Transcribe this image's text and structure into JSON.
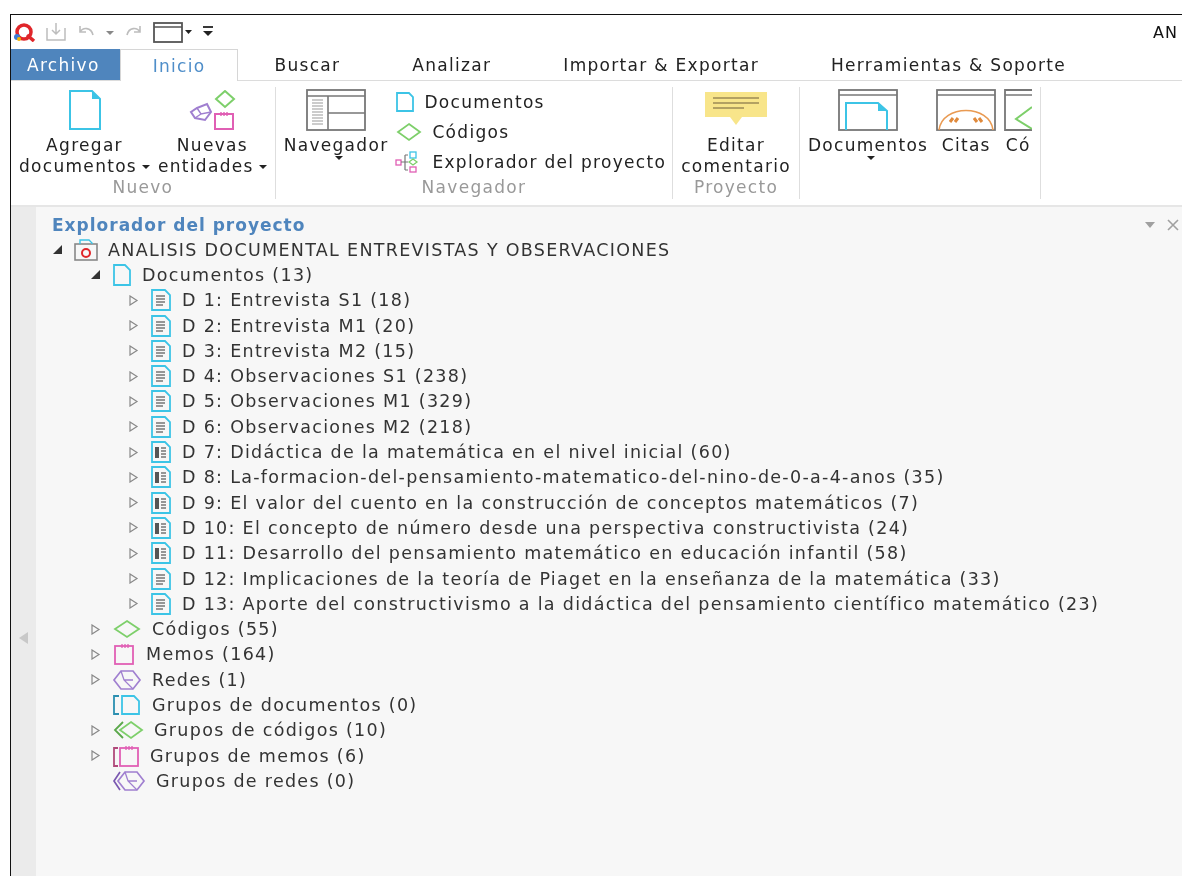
{
  "window": {
    "title": "AN"
  },
  "tabs": [
    {
      "label": "Archivo",
      "kind": "file",
      "selected": false
    },
    {
      "label": "Inicio",
      "kind": "tab",
      "selected": true
    },
    {
      "label": "Buscar",
      "kind": "tab",
      "selected": false
    },
    {
      "label": "Analizar",
      "kind": "tab",
      "selected": false
    },
    {
      "label": "Importar & Exportar",
      "kind": "tab",
      "selected": false
    },
    {
      "label": "Herramientas & Soporte",
      "kind": "tab",
      "selected": false
    }
  ],
  "ribbon": [
    {
      "label": "Nuevo",
      "buttons": [
        {
          "lines": [
            "Agregar",
            "documentos"
          ],
          "dropdown": true
        },
        {
          "lines": [
            "Nuevas",
            "entidades"
          ],
          "dropdown": true
        }
      ]
    },
    {
      "label": "Navegador",
      "buttons": [
        {
          "lines": [
            "Navegador"
          ],
          "dropdown": true
        }
      ],
      "stack": [
        {
          "label": "Documentos"
        },
        {
          "label": "Códigos"
        },
        {
          "label": "Explorador del proyecto"
        }
      ]
    },
    {
      "label": "Proyecto",
      "buttons": [
        {
          "lines": [
            "Editar",
            "comentario"
          ],
          "dropdown": false
        }
      ]
    },
    {
      "buttons": [
        {
          "lines": [
            "Documentos"
          ],
          "dropdown": true
        },
        {
          "lines": [
            "Citas"
          ],
          "dropdown": false
        },
        {
          "lines": [
            "Có"
          ],
          "dropdown": false
        }
      ]
    }
  ],
  "panel": {
    "title": "Explorador del proyecto"
  },
  "tree": [
    {
      "label": "ANALISIS DOCUMENTAL ENTREVISTAS Y OBSERVACIONES",
      "kind": "project",
      "expandable": true,
      "expanded": true,
      "children": [
        {
          "label": "Documentos (13)",
          "kind": "documents",
          "expandable": true,
          "expanded": true,
          "children": [
            {
              "label": "D 1: Entrevista S1 (18)",
              "kind": "text-doc",
              "expandable": true,
              "expanded": false
            },
            {
              "label": "D 2: Entrevista M1 (20)",
              "kind": "text-doc",
              "expandable": true,
              "expanded": false
            },
            {
              "label": "D 3: Entrevista M2 (15)",
              "kind": "text-doc",
              "expandable": true,
              "expanded": false
            },
            {
              "label": "D 4: Observaciones S1 (238)",
              "kind": "text-doc",
              "expandable": true,
              "expanded": false
            },
            {
              "label": "D 5: Observaciones M1 (329)",
              "kind": "text-doc",
              "expandable": true,
              "expanded": false
            },
            {
              "label": "D 6: Observaciones M2 (218)",
              "kind": "text-doc",
              "expandable": true,
              "expanded": false
            },
            {
              "label": "D 7: Didáctica de la matemática en el nivel inicial (60)",
              "kind": "pdf-doc",
              "expandable": true,
              "expanded": false
            },
            {
              "label": "D 8: La-formacion-del-pensamiento-matematico-del-nino-de-0-a-4-anos (35)",
              "kind": "pdf-doc",
              "expandable": true,
              "expanded": false
            },
            {
              "label": "D 9: El valor del cuento en la construcción de conceptos matemáticos (7)",
              "kind": "pdf-doc",
              "expandable": true,
              "expanded": false
            },
            {
              "label": "D 10: El concepto de número desde una perspectiva constructivista (24)",
              "kind": "pdf-doc",
              "expandable": true,
              "expanded": false
            },
            {
              "label": "D 11: Desarrollo del pensamiento matemático en educación infantil (58)",
              "kind": "pdf-doc",
              "expandable": true,
              "expanded": false
            },
            {
              "label": "D 12: Implicaciones de la teoría de Piaget en la enseñanza de la matemática (33)",
              "kind": "text-doc",
              "expandable": true,
              "expanded": false
            },
            {
              "label": "D 13: Aporte del constructivismo a la didáctica del pensamiento científico matemático (23)",
              "kind": "text-doc",
              "expandable": true,
              "expanded": false
            }
          ]
        },
        {
          "label": "Códigos (55)",
          "kind": "codes",
          "expandable": true,
          "expanded": false
        },
        {
          "label": "Memos (164)",
          "kind": "memos",
          "expandable": true,
          "expanded": false
        },
        {
          "label": "Redes (1)",
          "kind": "networks",
          "expandable": true,
          "expanded": false
        },
        {
          "label": "Grupos de documentos (0)",
          "kind": "doc-groups",
          "expandable": false
        },
        {
          "label": "Grupos de códigos (10)",
          "kind": "code-groups",
          "expandable": true,
          "expanded": false
        },
        {
          "label": "Grupos de memos (6)",
          "kind": "memo-groups",
          "expandable": true,
          "expanded": false
        },
        {
          "label": "Grupos de redes (0)",
          "kind": "network-groups",
          "expandable": false
        }
      ]
    }
  ]
}
